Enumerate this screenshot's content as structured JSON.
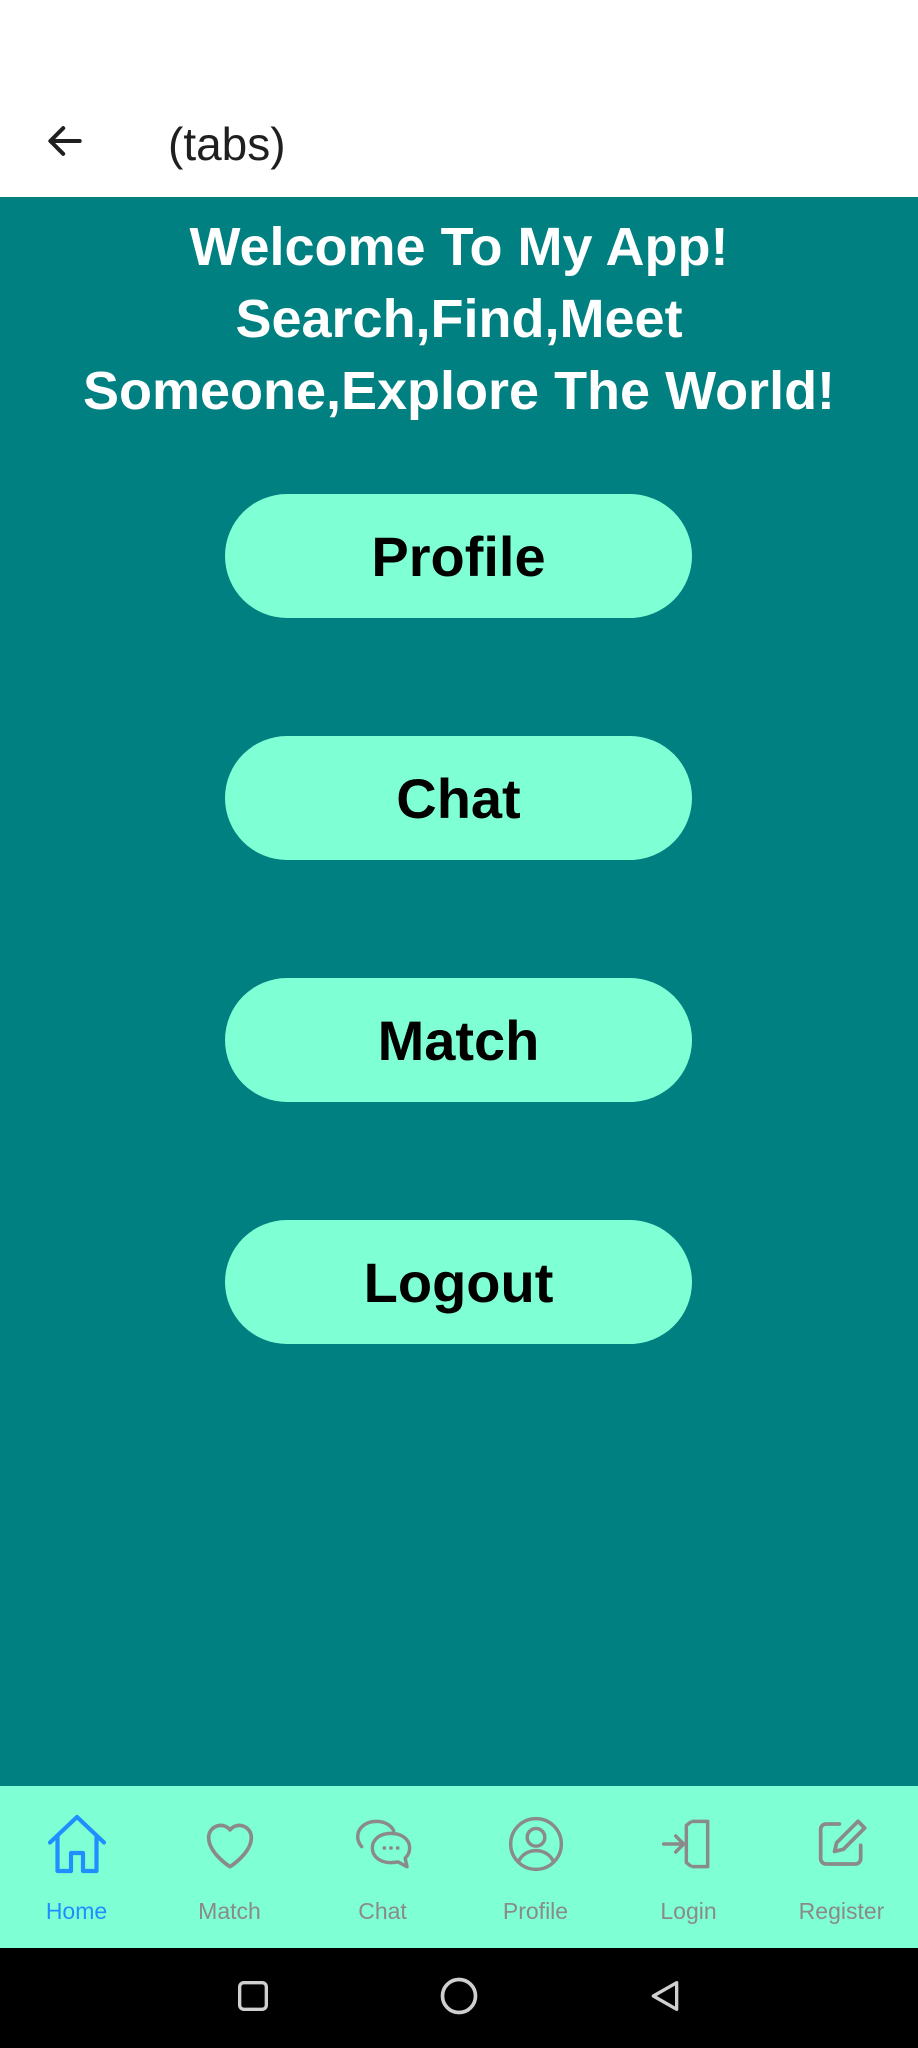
{
  "header": {
    "title": "(tabs)",
    "back_icon": "arrow-left-icon"
  },
  "main": {
    "welcome_lines": [
      "Welcome To My App!",
      "Search,Find,Meet",
      "Someone,Explore The World!"
    ],
    "buttons": {
      "profile": "Profile",
      "chat": "Chat",
      "match": "Match",
      "logout": "Logout"
    }
  },
  "tabs": [
    {
      "label": "Home",
      "icon": "home-icon",
      "active": true
    },
    {
      "label": "Match",
      "icon": "heart-icon",
      "active": false
    },
    {
      "label": "Chat",
      "icon": "chat-bubbles-icon",
      "active": false
    },
    {
      "label": "Profile",
      "icon": "user-circle-icon",
      "active": false
    },
    {
      "label": "Login",
      "icon": "login-icon",
      "active": false
    },
    {
      "label": "Register",
      "icon": "edit-icon",
      "active": false
    }
  ],
  "colors": {
    "background": "#008080",
    "accent": "#7fffd4",
    "active_tab": "#1f8fff",
    "inactive_tab": "#8a8a8a"
  },
  "system_nav": [
    "recents-icon",
    "home-circle-icon",
    "back-triangle-icon"
  ]
}
